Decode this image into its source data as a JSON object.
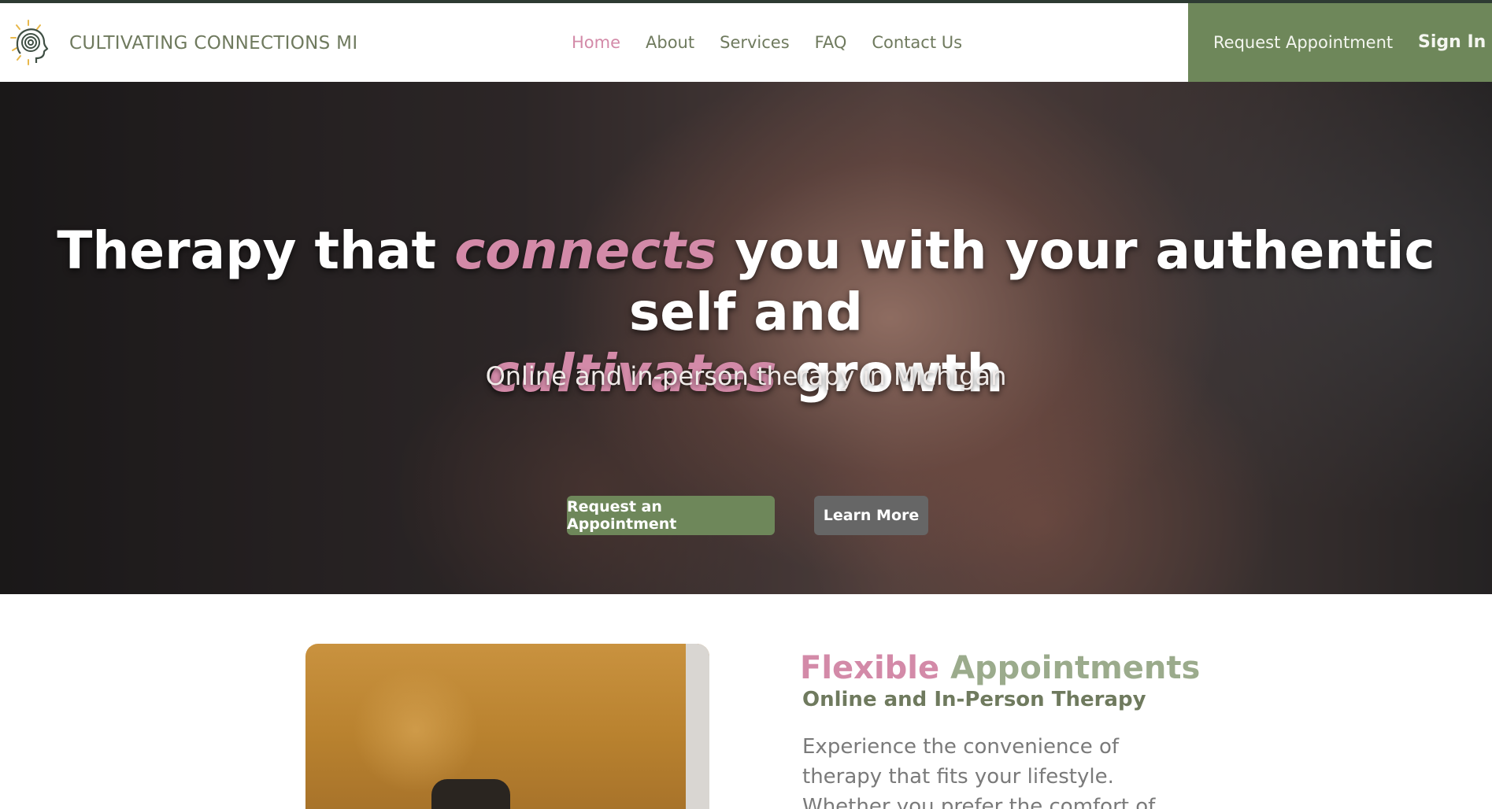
{
  "header": {
    "brand": "CULTIVATING CONNECTIONS MI",
    "nav": [
      {
        "label": "Home",
        "active": true
      },
      {
        "label": "About",
        "active": false
      },
      {
        "label": "Services",
        "active": false
      },
      {
        "label": "FAQ",
        "active": false
      },
      {
        "label": "Contact Us",
        "active": false
      }
    ],
    "request_label": "Request Appointment",
    "signin_label": "Sign In"
  },
  "hero": {
    "title_part1": "Therapy that ",
    "title_accent1": "connects",
    "title_part2": " you with your authentic self and",
    "title_accent2": "cultivates",
    "title_part3": " growth",
    "subtitle": "Online and in-person therapy in Michigan",
    "primary_button": "Request an Appointment",
    "secondary_button": "Learn More"
  },
  "feature": {
    "title_word1": "Flexible",
    "title_word2": "Appointments",
    "subtitle": "Online and In-Person Therapy",
    "body": "Experience the convenience of therapy that fits your lifestyle. Whether you prefer the comfort of"
  },
  "colors": {
    "accent_pink": "#d38aa8",
    "brand_green": "#6e875a",
    "text_green": "#6f7a5e"
  }
}
